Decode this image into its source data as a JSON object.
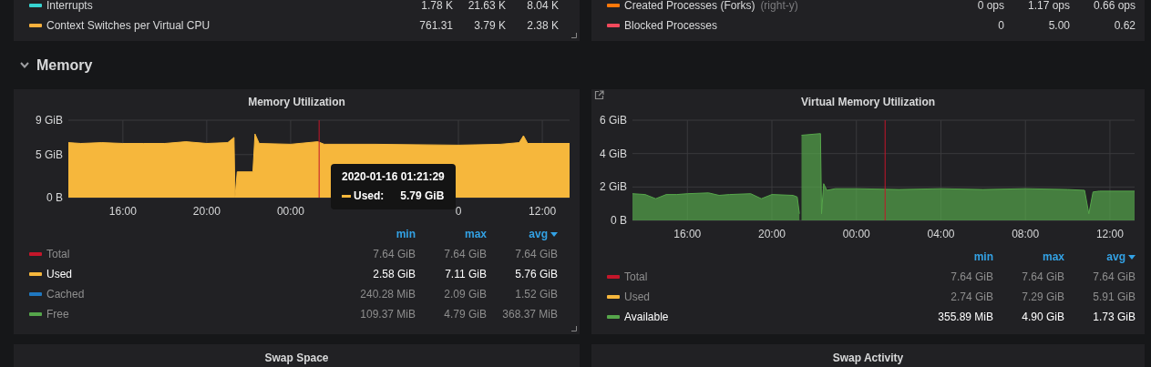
{
  "top_panels": [
    {
      "resize_handle": true,
      "legend": [
        {
          "name": "Interrupts",
          "color": "#37d3d0",
          "min": "1.78 K",
          "max": "21.63 K",
          "avg": "8.04 K"
        },
        {
          "name": "Context Switches per Virtual CPU",
          "color": "#f9b03c",
          "min": "761.31",
          "max": "3.79 K",
          "avg": "2.38 K"
        }
      ]
    },
    {
      "resize_handle": false,
      "legend": [
        {
          "name": "Created Processes (Forks)",
          "note": "(right-y)",
          "color": "#ff780a",
          "min": "0 ops",
          "max": "1.17 ops",
          "avg": "0.66 ops"
        },
        {
          "name": "Blocked Processes",
          "color": "#f2495c",
          "min": "0",
          "max": "5.00",
          "avg": "0.62"
        }
      ]
    }
  ],
  "row": {
    "title": "Memory",
    "expanded": true
  },
  "panels": [
    {
      "title": "Memory Utilization",
      "link_icon": false,
      "resize_handle": true,
      "chart_data": {
        "type": "area",
        "grid": true,
        "xlim": [
          "2020-01-15 13:24",
          "2020-01-16 13:18"
        ],
        "ylim": [
          0,
          9
        ],
        "xticks": [
          {
            "value": "2020-01-15 16:00",
            "label": "16:00"
          },
          {
            "value": "2020-01-15 20:00",
            "label": "20:00"
          },
          {
            "value": "2020-01-16 00:00",
            "label": "00:00"
          },
          {
            "value": "2020-01-16 08:00",
            "label": "0"
          },
          {
            "value": "2020-01-16 12:00",
            "label": "12:00"
          }
        ],
        "yticks": [
          {
            "value": 0,
            "label": "0 B"
          },
          {
            "value": 5,
            "label": "5 GiB"
          },
          {
            "value": 9,
            "label": "9 GiB"
          }
        ],
        "x": [
          "2020-01-15 13:24",
          "2020-01-15 14:00",
          "2020-01-15 15:00",
          "2020-01-15 16:00",
          "2020-01-15 17:00",
          "2020-01-15 18:00",
          "2020-01-15 19:00",
          "2020-01-15 20:00",
          "2020-01-15 21:00",
          "2020-01-15 21:18",
          "2020-01-15 21:21",
          "2020-01-15 21:27",
          "2020-01-15 22:12",
          "2020-01-15 22:18",
          "2020-01-15 22:30",
          "2020-01-16 00:00",
          "2020-01-16 01:18",
          "2020-01-16 01:36",
          "2020-01-16 04:00",
          "2020-01-16 08:00",
          "2020-01-16 10:00",
          "2020-01-16 10:54",
          "2020-01-16 11:06",
          "2020-01-16 11:18",
          "2020-01-16 13:18"
        ],
        "series": [
          {
            "color": "#f6b73c",
            "values": [
              6.4,
              6.3,
              6.4,
              6.3,
              6.3,
              6.3,
              6.5,
              6.3,
              6.4,
              7.0,
              0,
              3.0,
              3.0,
              7.4,
              6.3,
              6.2,
              6.5,
              6.2,
              6.2,
              6.1,
              6.2,
              6.4,
              7.2,
              6.3,
              6.3
            ]
          }
        ],
        "ref_lines": [
          {
            "axis": "x",
            "value": "2020-01-16 01:21:29",
            "color": "#c4162a"
          }
        ]
      },
      "tooltip": {
        "time": "2020-01-16 01:21:29",
        "series": "Used:",
        "value": "5.79 GiB",
        "color": "#f6b73c"
      },
      "legend": {
        "columns": [
          {
            "label": "min",
            "sorted": false
          },
          {
            "label": "max",
            "sorted": false
          },
          {
            "label": "avg",
            "sorted": true
          }
        ],
        "rows": [
          {
            "name": "Total",
            "color": "#c4162a",
            "highlighted": false,
            "min": "7.64 GiB",
            "max": "7.64 GiB",
            "avg": "7.64 GiB"
          },
          {
            "name": "Used",
            "color": "#f6b73c",
            "highlighted": true,
            "min": "2.58 GiB",
            "max": "7.11 GiB",
            "avg": "5.76 GiB"
          },
          {
            "name": "Cached",
            "color": "#1f78c1",
            "highlighted": false,
            "min": "240.28 MiB",
            "max": "2.09 GiB",
            "avg": "1.52 GiB"
          },
          {
            "name": "Free",
            "color": "#56a64b",
            "highlighted": false,
            "min": "109.37 MiB",
            "max": "4.79 GiB",
            "avg": "368.37 MiB"
          }
        ]
      }
    },
    {
      "title": "Virtual Memory Utilization",
      "link_icon": true,
      "resize_handle": false,
      "chart_data": {
        "type": "area",
        "grid": true,
        "xlim": [
          "2020-01-15 13:24",
          "2020-01-16 13:10"
        ],
        "ylim": [
          0,
          6
        ],
        "xticks": [
          {
            "value": "2020-01-15 16:00",
            "label": "16:00"
          },
          {
            "value": "2020-01-15 20:00",
            "label": "20:00"
          },
          {
            "value": "2020-01-16 00:00",
            "label": "00:00"
          },
          {
            "value": "2020-01-16 04:00",
            "label": "04:00"
          },
          {
            "value": "2020-01-16 08:00",
            "label": "08:00"
          },
          {
            "value": "2020-01-16 12:00",
            "label": "12:00"
          }
        ],
        "yticks": [
          {
            "value": 0,
            "label": "0 B"
          },
          {
            "value": 2,
            "label": "2 GiB"
          },
          {
            "value": 4,
            "label": "4 GiB"
          },
          {
            "value": 6,
            "label": "6 GiB"
          }
        ],
        "x": [
          "2020-01-15 13:24",
          "2020-01-15 14:00",
          "2020-01-15 14:30",
          "2020-01-15 15:00",
          "2020-01-15 15:30",
          "2020-01-15 16:00",
          "2020-01-15 17:00",
          "2020-01-15 17:30",
          "2020-01-15 18:00",
          "2020-01-15 19:00",
          "2020-01-15 19:30",
          "2020-01-15 20:00",
          "2020-01-15 21:00",
          "2020-01-15 21:12",
          "2020-01-15 21:18",
          "2020-01-15 21:21",
          "2020-01-15 21:24",
          "2020-01-15 22:18",
          "2020-01-15 22:21",
          "2020-01-15 22:27",
          "2020-01-15 22:36",
          "2020-01-15 23:00",
          "2020-01-16 00:00",
          "2020-01-16 02:00",
          "2020-01-16 04:00",
          "2020-01-16 06:00",
          "2020-01-16 08:00",
          "2020-01-16 10:00",
          "2020-01-16 10:48",
          "2020-01-16 11:00",
          "2020-01-16 11:12",
          "2020-01-16 11:30",
          "2020-01-16 12:00",
          "2020-01-16 13:10"
        ],
        "series": [
          {
            "color": "#56a64b",
            "values": [
              1.6,
              1.55,
              1.3,
              1.55,
              1.55,
              1.6,
              1.65,
              1.5,
              1.55,
              1.6,
              1.3,
              1.55,
              1.5,
              1.4,
              0.4,
              null,
              5.1,
              5.2,
              0.4,
              2.2,
              1.8,
              1.9,
              1.9,
              1.85,
              1.9,
              1.85,
              1.9,
              1.85,
              1.8,
              0.4,
              1.7,
              1.75,
              1.75,
              1.75
            ]
          }
        ],
        "ref_lines": [
          {
            "axis": "x",
            "value": "2020-01-16 01:21:29",
            "color": "#c4162a"
          }
        ]
      },
      "legend": {
        "columns": [
          {
            "label": "min",
            "sorted": false
          },
          {
            "label": "max",
            "sorted": false
          },
          {
            "label": "avg",
            "sorted": true
          }
        ],
        "rows": [
          {
            "name": "Total",
            "color": "#c4162a",
            "highlighted": false,
            "min": "7.64 GiB",
            "max": "7.64 GiB",
            "avg": "7.64 GiB"
          },
          {
            "name": "Used",
            "color": "#f6b73c",
            "highlighted": false,
            "min": "2.74 GiB",
            "max": "7.29 GiB",
            "avg": "5.91 GiB"
          },
          {
            "name": "Available",
            "color": "#56a64b",
            "highlighted": true,
            "min": "355.89 MiB",
            "max": "4.90 GiB",
            "avg": "1.73 GiB"
          }
        ]
      }
    }
  ],
  "bottom_panels": [
    {
      "title": "Swap Space"
    },
    {
      "title": "Swap Activity"
    }
  ]
}
